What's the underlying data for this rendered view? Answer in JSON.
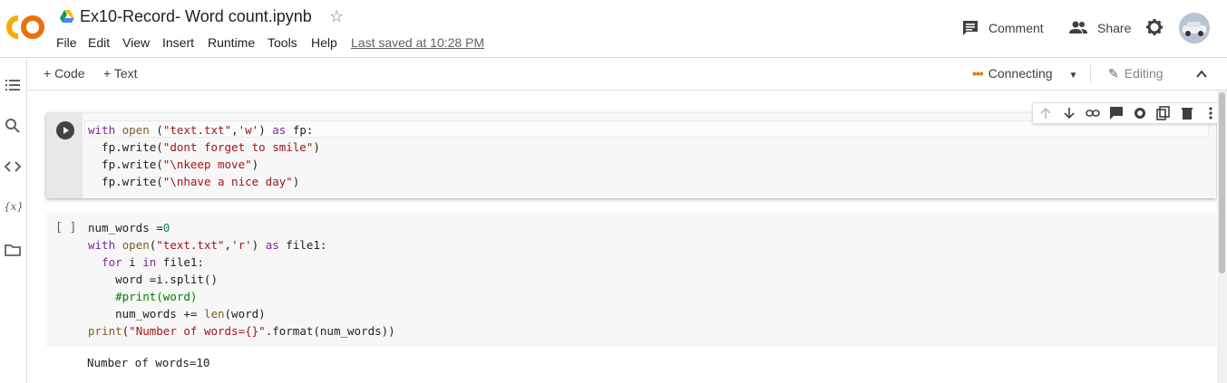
{
  "header": {
    "title": "Ex10-Record- Word count.ipynb",
    "last_saved": "Last saved at 10:28 PM",
    "menu": [
      "File",
      "Edit",
      "View",
      "Insert",
      "Runtime",
      "Tools",
      "Help"
    ],
    "comment_label": "Comment",
    "share_label": "Share"
  },
  "toolbar": {
    "add_code": "+ Code",
    "add_text": "+ Text",
    "connection_status": "Connecting",
    "dots": "•••",
    "mode": "Editing"
  },
  "cells": [
    {
      "type": "code",
      "lines": [
        "with open (\"text.txt\",'w') as fp:",
        "  fp.write(\"dont forget to smile\")",
        "  fp.write(\"\\nkeep move\")",
        "  fp.write(\"\\nhave a nice day\")"
      ]
    },
    {
      "type": "code",
      "execution_indicator": "[ ]",
      "lines": [
        "num_words =0",
        "with open(\"text.txt\",'r') as file1:",
        "  for i in file1:",
        "    word =i.split()",
        "    #print(word)",
        "    num_words += len(word)",
        "print(\"Number of words={}\".format(num_words))"
      ],
      "output": "Number of words=10"
    }
  ],
  "colors": {
    "keyword": "#7928a1",
    "string": "#a31515",
    "number": "#098658",
    "comment": "#008000",
    "connecting_dots": "#e37400",
    "logo_orange": "#f9ab00"
  }
}
